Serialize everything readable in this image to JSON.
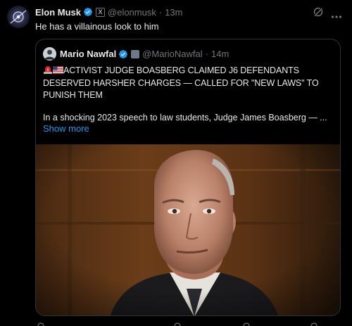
{
  "post": {
    "author_name": "Elon Musk",
    "author_handle": "@elonmusk",
    "dot": "·",
    "time": "13m",
    "badge_label": "X",
    "text": "He has a villainous look to him"
  },
  "quoted_post": {
    "author_name": "Mario Nawfal",
    "author_handle": "@MarioNawfal",
    "dot": "·",
    "time": "14m",
    "headline": "ACTIVIST JUDGE BOASBERG CLAIMED J6 DEFENDANTS DESERVED HARSHER CHARGES — CALLED FOR \"NEW LAWS\" TO PUNISH THEM",
    "body": "In a shocking 2023 speech to law students, Judge James Boasberg — ...",
    "show_more_label": "Show more",
    "media_icon": "photo-of-man-in-suit"
  },
  "icons": {
    "verified": "verified-badge-icon",
    "grok": "grok-icon",
    "more": "more-icon"
  },
  "colors": {
    "background": "#000000",
    "text": "#e7e9ea",
    "secondary_text": "#71767b",
    "link": "#1d9bf0",
    "verified": "#1d9bf0",
    "border": "#2f3336"
  }
}
